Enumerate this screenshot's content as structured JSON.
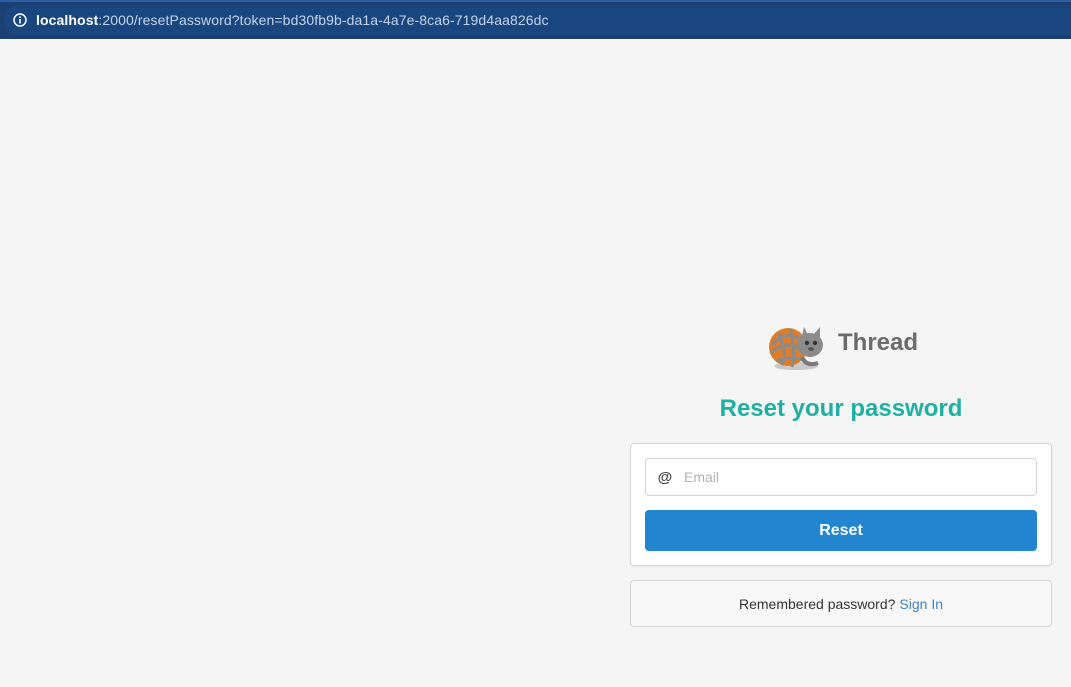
{
  "browser": {
    "url_host": "localhost",
    "url_rest": ":2000/resetPassword?token=bd30fb9b-da1a-4a7e-8ca6-719d4aa826dc",
    "info_icon": "info-icon"
  },
  "brand": {
    "name": "Thread",
    "logo_icon": "thread-logo-icon"
  },
  "form": {
    "heading": "Reset your password",
    "email_icon": "@",
    "email_placeholder": "Email",
    "email_value": "",
    "reset_label": "Reset"
  },
  "footer": {
    "prompt": "Remembered password?",
    "signin_label": "Sign In"
  },
  "colors": {
    "heading": "#1fb0a5",
    "button": "#2185d0",
    "link": "#4183c4",
    "address_bar": "#1c3f73"
  }
}
